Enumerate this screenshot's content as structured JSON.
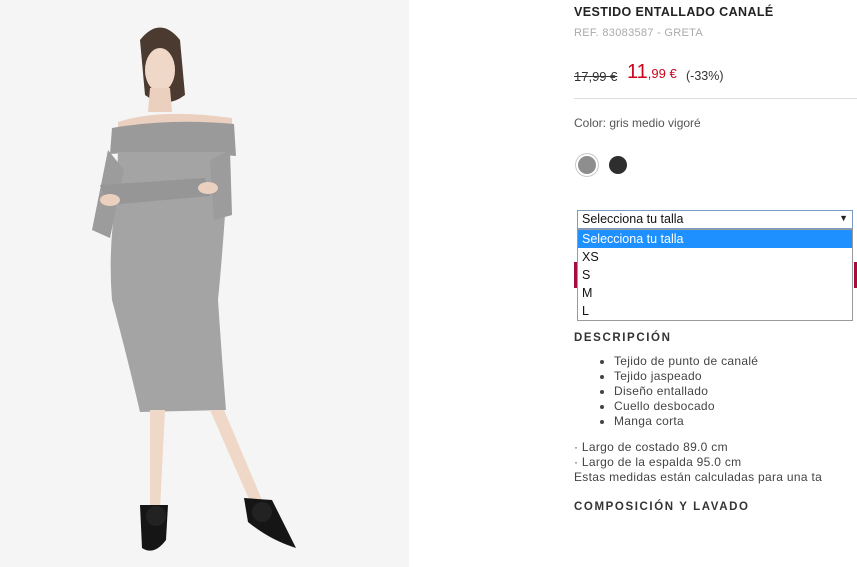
{
  "product": {
    "title": "VESTIDO ENTALLADO CANALÉ",
    "ref": "REF. 83083587 - GRETA",
    "old_price": "17,99 €",
    "new_price_int": "11",
    "new_price_dec": ",99 €",
    "discount": "(-33%)",
    "color_label": "Color: gris medio vigoré",
    "swatches": [
      {
        "name": "gris medio vigoré",
        "color": "#8e8e8e",
        "selected": true
      },
      {
        "name": "negro",
        "color": "#2e2e2e",
        "selected": false
      }
    ]
  },
  "size_select": {
    "selected": "Selecciona tu talla",
    "options": [
      "Selecciona tu talla",
      "XS",
      "S",
      "M",
      "L"
    ]
  },
  "description": {
    "heading": "DESCRIPCIÓN",
    "items": [
      "Tejido de punto de canalé",
      "Tejido jaspeado",
      "Diseño entallado",
      "Cuello desbocado",
      "Manga corta"
    ],
    "measure_1": "· Largo de costado 89.0 cm",
    "measure_2": "· Largo de la espalda 95.0 cm",
    "measure_note": "Estas medidas están calculadas para una ta"
  },
  "composition": {
    "heading": "COMPOSICIÓN Y LAVADO"
  },
  "colors": {
    "price_red": "#d0021b",
    "add_button": "#a50d3c",
    "dropdown_highlight": "#1e90ff"
  }
}
